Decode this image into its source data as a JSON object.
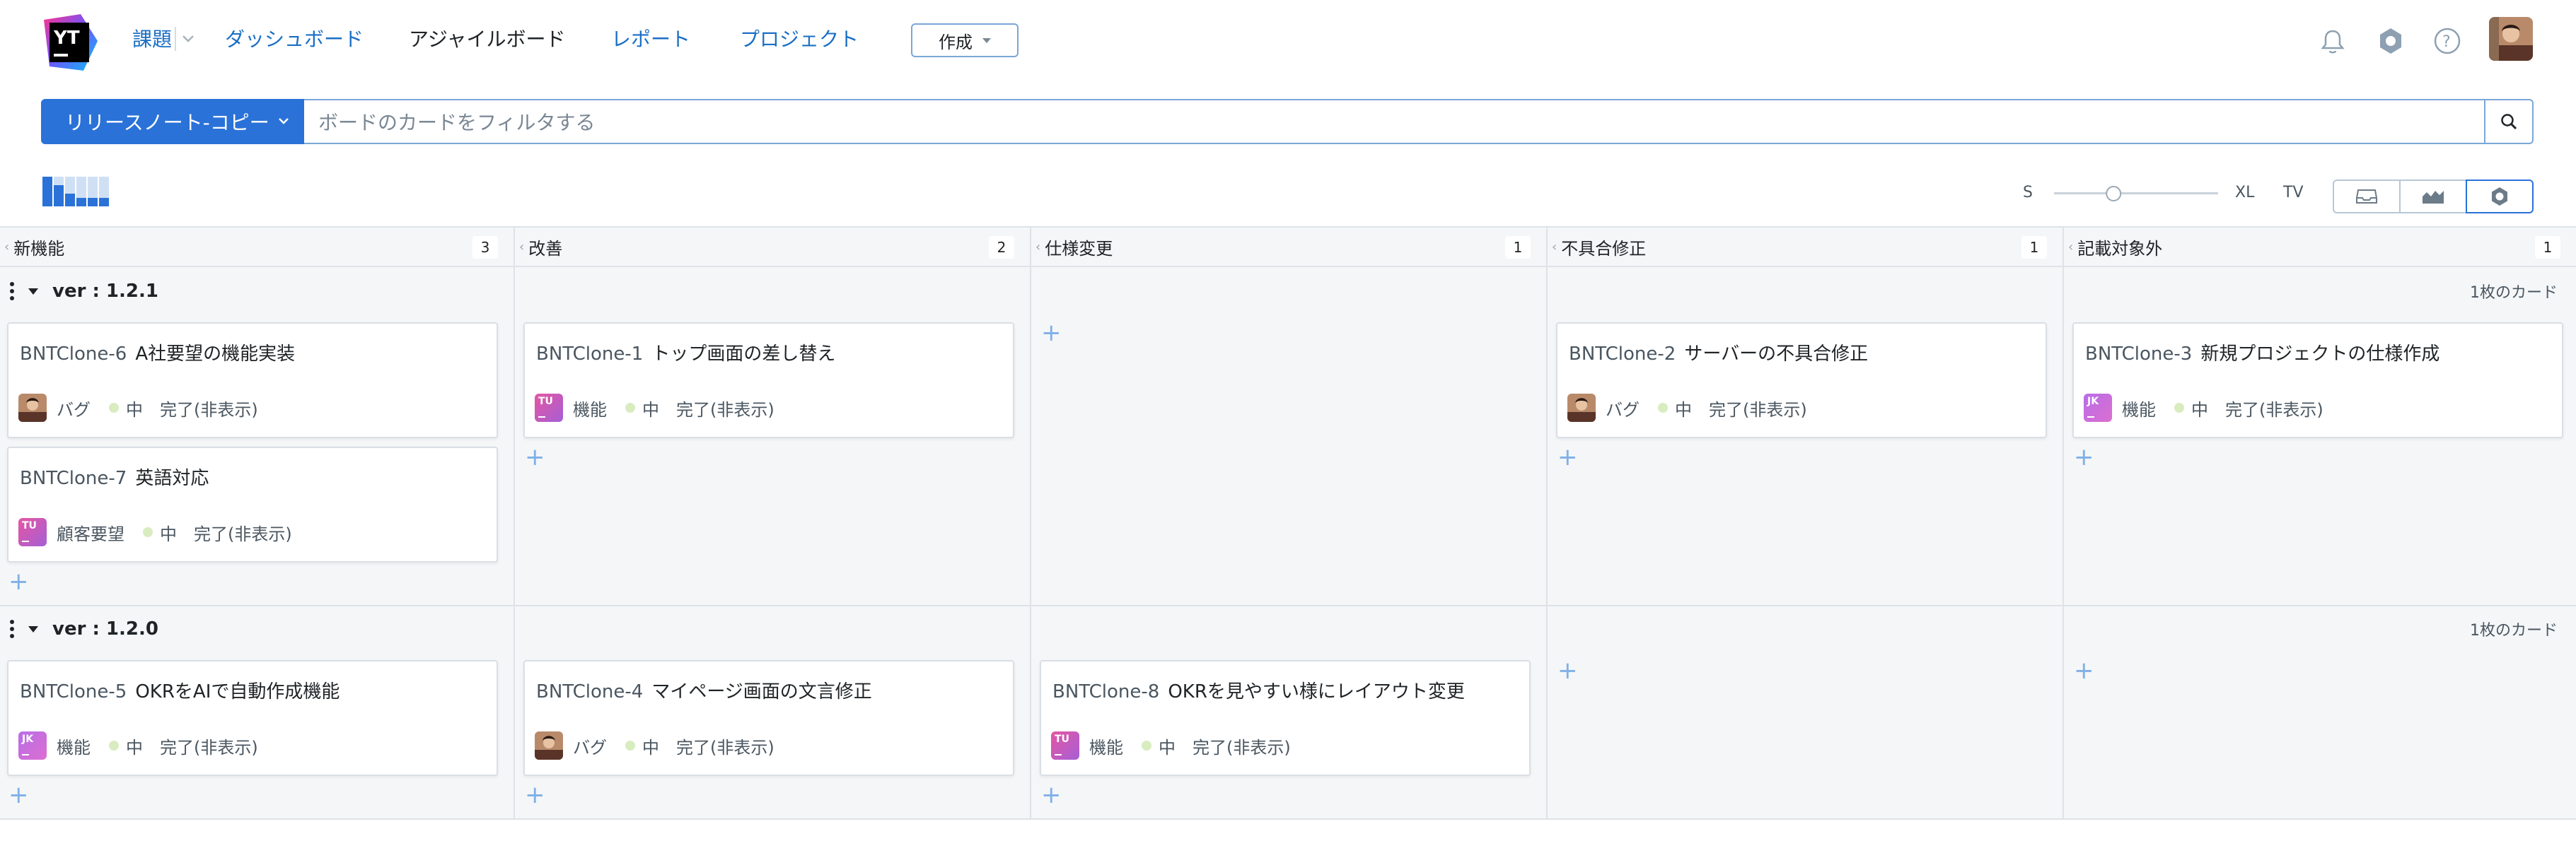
{
  "header": {
    "logo_text": "YT",
    "nav": [
      "課題",
      "ダッシュボード",
      "アジャイルボード",
      "レポート",
      "プロジェクト"
    ],
    "create_label": "作成",
    "icons": [
      "bell-icon",
      "hub-icon",
      "help-icon",
      "user-avatar"
    ]
  },
  "search": {
    "query_label": "リリースノート-コピー",
    "placeholder": "ボードのカードをフィルタする"
  },
  "toolbar": {
    "size_s": "S",
    "size_xl": "XL",
    "size_tv": "TV",
    "card_size_level": 0.35
  },
  "columns": [
    {
      "name": "新機能",
      "count": "3"
    },
    {
      "name": "改善",
      "count": "2"
    },
    {
      "name": "仕様変更",
      "count": "1"
    },
    {
      "name": "不具合修正",
      "count": "1"
    },
    {
      "name": "記載対象外",
      "count": "1"
    }
  ],
  "swimlanes": [
    {
      "title": "ver : 1.2.1",
      "cards_label": "1枚のカード",
      "cards": [
        {
          "id": "BNTClone-6",
          "title": "A社要望の機能実装",
          "type": "バグ",
          "priority": "中",
          "state": "完了(非表示)",
          "avatar": "photo"
        },
        {
          "id": "BNTClone-7",
          "title": "英語対応",
          "type": "顧客要望",
          "priority": "中",
          "state": "完了(非表示)",
          "avatar": "TU"
        },
        {
          "id": "BNTClone-1",
          "title": "トップ画面の差し替え",
          "type": "機能",
          "priority": "中",
          "state": "完了(非表示)",
          "avatar": "TU"
        },
        {
          "id": "BNTClone-2",
          "title": "サーバーの不具合修正",
          "type": "バグ",
          "priority": "中",
          "state": "完了(非表示)",
          "avatar": "photo"
        },
        {
          "id": "BNTClone-3",
          "title": "新規プロジェクトの仕様作成",
          "type": "機能",
          "priority": "中",
          "state": "完了(非表示)",
          "avatar": "JK"
        }
      ]
    },
    {
      "title": "ver : 1.2.0",
      "cards_label": "1枚のカード",
      "cards": [
        {
          "id": "BNTClone-5",
          "title": "OKRをAIで自動作成機能",
          "type": "機能",
          "priority": "中",
          "state": "完了(非表示)",
          "avatar": "JK"
        },
        {
          "id": "BNTClone-4",
          "title": "マイページ画面の文言修正",
          "type": "バグ",
          "priority": "中",
          "state": "完了(非表示)",
          "avatar": "photo"
        },
        {
          "id": "BNTClone-8",
          "title": "OKRを見やすい様にレイアウト変更",
          "type": "機能",
          "priority": "中",
          "state": "完了(非表示)",
          "avatar": "TU"
        }
      ]
    }
  ],
  "colors": {
    "accent": "#2a72d8",
    "link": "#1a6fc4",
    "priority_dot": "#d8ecc0"
  }
}
